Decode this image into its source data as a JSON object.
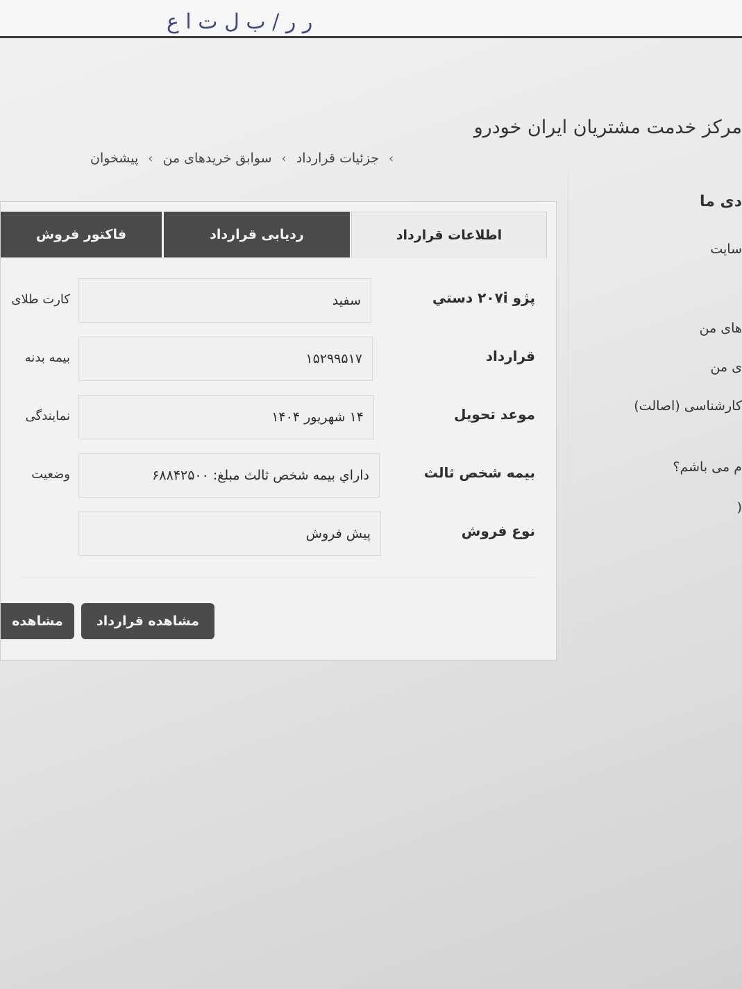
{
  "prev_sheet": {
    "scribble": "ر ر / ب ل ت ا ع"
  },
  "header": {
    "site_title": "مرکز خدمت مشتریان ایران خودرو"
  },
  "breadcrumb": {
    "items": [
      "پیشخوان",
      "سوابق خریدهای من",
      "جزئیات قرارداد"
    ],
    "separator": "›"
  },
  "sidebar": {
    "items": [
      "دی ما",
      "سایت",
      "های من",
      "ی من",
      "کارشناسی (اصالت)",
      "م می باشم؟",
      "("
    ]
  },
  "tabs": [
    {
      "label": "اطلاعات قرارداد",
      "active": true
    },
    {
      "label": "ردیابی قرارداد",
      "active": false
    },
    {
      "label": "فاکتور فروش",
      "active": false
    }
  ],
  "details": {
    "rows": [
      {
        "label": "پژو ۲۰۷i دستي",
        "value": "سفید",
        "left_label": "کارت طلای"
      },
      {
        "label": "قرارداد",
        "value": "۱۵۲۹۹۵۱۷",
        "left_label": "بیمه بدنه"
      },
      {
        "label": "موعد تحویل",
        "value": "۱۴ شهریور ۱۴۰۴",
        "left_label": "نمایندگی"
      },
      {
        "label": "بیمه شخص ثالث",
        "value": "داراي بیمه شخص ثالث مبلغ: ۶۸۸۴۲۵۰۰",
        "left_label": "وضعیت"
      },
      {
        "label": "نوع فروش",
        "value": "پیش فروش",
        "left_label": ""
      }
    ]
  },
  "actions": {
    "view_contract": "مشاهده قرارداد",
    "view": "مشاهده"
  },
  "colors": {
    "dark_tab": "#4a4a4a",
    "button": "#4b4b4b",
    "panel_bg": "#f2f2f2"
  }
}
